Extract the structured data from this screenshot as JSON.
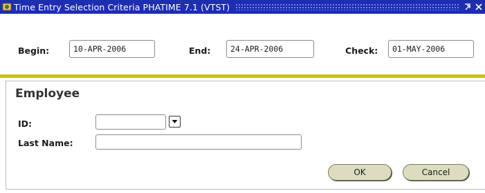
{
  "window": {
    "title": "Time Entry Selection Criteria   PHATIME  7.1  (VTST)",
    "icons": {
      "app": "app-icon",
      "maximize": "maximize-icon",
      "close": "close-icon"
    }
  },
  "dates": {
    "begin_label": "Begin:",
    "begin_value": "10-APR-2006",
    "end_label": "End:",
    "end_value": "24-APR-2006",
    "check_label": "Check:",
    "check_value": "01-MAY-2006"
  },
  "employee": {
    "section_title": "Employee",
    "id_label": "ID:",
    "id_value": "",
    "last_name_label": "Last Name:",
    "last_name_value": ""
  },
  "buttons": {
    "ok_label": "OK",
    "cancel_label": "Cancel"
  },
  "colors": {
    "titlebar": "#1e2eb0",
    "divider": "#c7c400",
    "button_fill": "#dcdcc0"
  }
}
